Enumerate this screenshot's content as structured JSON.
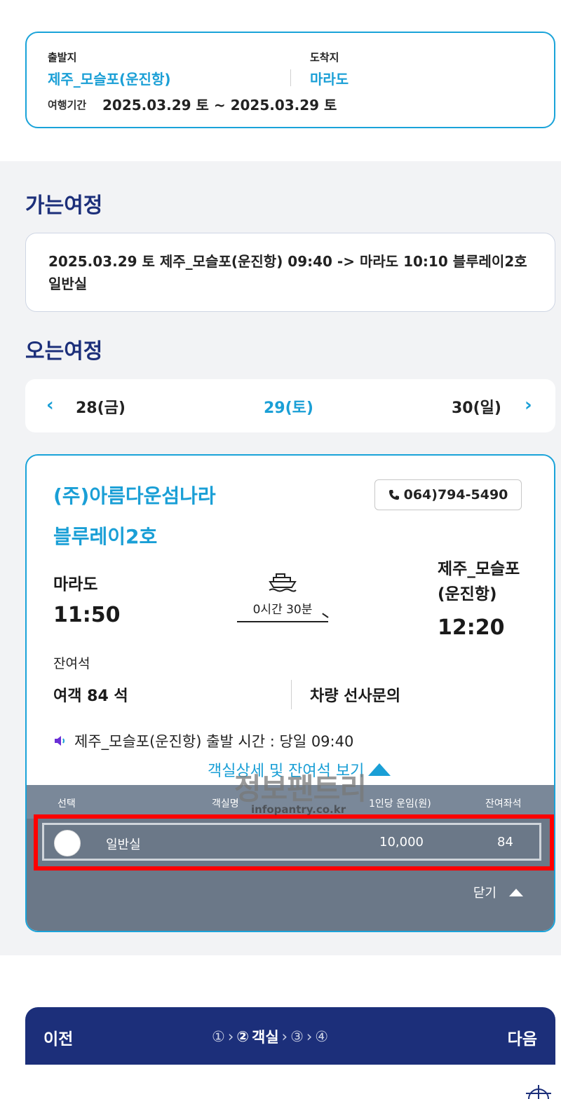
{
  "summary": {
    "departure_label": "출발지",
    "departure_value": "제주_모슬포(운진항)",
    "arrival_label": "도착지",
    "arrival_value": "마라도",
    "period_label": "여행기간",
    "period_value": "2025.03.29 토 ~ 2025.03.29 토"
  },
  "going": {
    "title": "가는여정",
    "line1": "2025.03.29 토 제주_모슬포(운진항) 09:40 -> 마라도 10:10 블루레이2호",
    "line2": "일반실"
  },
  "returning": {
    "title": "오는여정",
    "dates": {
      "prev": "28(금)",
      "current": "29(토)",
      "next": "30(일)"
    }
  },
  "card": {
    "company": "(주)아름다운섬나라",
    "ship": "블루레이2호",
    "phone": "064)794-5490",
    "departure_port": "마라도",
    "departure_time": "11:50",
    "arrival_port_line1": "제주_모슬포",
    "arrival_port_line2": "(운진항)",
    "arrival_time": "12:20",
    "duration": "0시간 30분",
    "remain_label": "잔여석",
    "passenger_seats": "여객 84 석",
    "car_seats": "차량 선사문의",
    "notice": "제주_모슬포(운진항) 출발 시간 : 당일 09:40",
    "toggle_label": "객실상세 및 잔여석 보기"
  },
  "watermark": {
    "main": "정보팬트리",
    "sub": "infopantry.co.kr"
  },
  "table": {
    "headers": [
      "선택",
      "객실명",
      "1인당 운임(원)",
      "잔여좌석"
    ],
    "rows": [
      {
        "room": "일반실",
        "fare": "10,000",
        "remaining": "84"
      }
    ],
    "close_label": "닫기"
  },
  "bottom": {
    "prev": "이전",
    "next": "다음",
    "steps": [
      "①",
      "②",
      "객실",
      "③",
      "④"
    ]
  },
  "colors": {
    "accent": "#1a9fd6",
    "navy": "#1c2f7a",
    "table": "#6b7888",
    "highlight": "#ff0000"
  }
}
